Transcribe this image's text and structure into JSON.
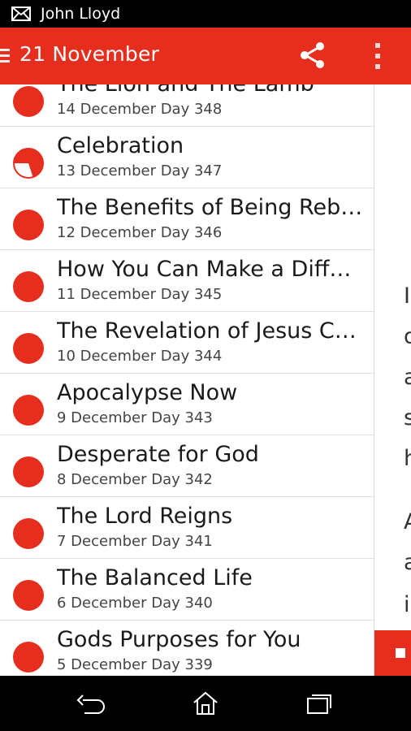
{
  "status_bar": {
    "text": "John Lloyd",
    "icon": "mail-icon"
  },
  "action_bar": {
    "title": "21 November",
    "share_icon": "share-icon",
    "overflow_icon": "overflow-menu-icon",
    "drawer_icon": "drawer-icon"
  },
  "list": [
    {
      "title": "The Lion and The Lamb",
      "subtitle": "14 December Day 348",
      "progress": 1.0
    },
    {
      "title": "Celebration",
      "subtitle": "13 December Day 347",
      "progress": 0.3
    },
    {
      "title": "The Benefits of Being Reb…",
      "subtitle": "12 December Day 346",
      "progress": 1.0
    },
    {
      "title": "How You Can Make a Diff…",
      "subtitle": "11 December Day 345",
      "progress": 1.0
    },
    {
      "title": "The Revelation of Jesus C…",
      "subtitle": "10 December Day 344",
      "progress": 1.0
    },
    {
      "title": "Apocalypse Now",
      "subtitle": "9 December Day 343",
      "progress": 1.0
    },
    {
      "title": "Desperate for God",
      "subtitle": "8 December Day 342",
      "progress": 1.0
    },
    {
      "title": "The Lord Reigns",
      "subtitle": "7 December Day 341",
      "progress": 1.0
    },
    {
      "title": "The Balanced Life",
      "subtitle": "6 December Day 340",
      "progress": 1.0
    },
    {
      "title": "Gods Purposes for You",
      "subtitle": "5 December Day 339",
      "progress": 1.0
    }
  ],
  "detail_fragments": [
    "I",
    "d",
    "a",
    "s",
    "h",
    "A",
    "a",
    "i"
  ],
  "colors": {
    "accent": "#e62e1e"
  },
  "nav_bar": {
    "back_icon": "back-icon",
    "home_icon": "home-icon",
    "recents_icon": "recents-icon"
  }
}
